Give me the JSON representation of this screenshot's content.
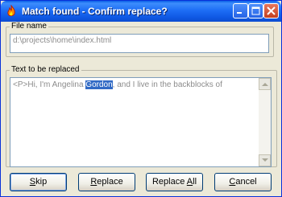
{
  "window": {
    "title": "Match found - Confirm replace?",
    "icons": [
      "app-flame-icon",
      "minimize-icon",
      "maximize-icon",
      "close-icon"
    ]
  },
  "file_group": {
    "label": "File name",
    "value": "d:\\projects\\home\\index.html"
  },
  "text_group": {
    "label": "Text to be replaced",
    "before": "<P>Hi, I'm Angelina ",
    "match": "Gordon",
    "after": ", and I live in the backblocks of"
  },
  "buttons": {
    "skip_u": "S",
    "skip_rest": "kip",
    "replace_u": "R",
    "replace_rest": "eplace",
    "replace_all_pre": "Replace ",
    "replace_all_u": "A",
    "replace_all_rest": "ll",
    "cancel_u": "C",
    "cancel_rest": "ancel"
  },
  "colors": {
    "titlebar": "#0f58e3",
    "highlight": "#316ac5",
    "close_button": "#c3401f"
  }
}
